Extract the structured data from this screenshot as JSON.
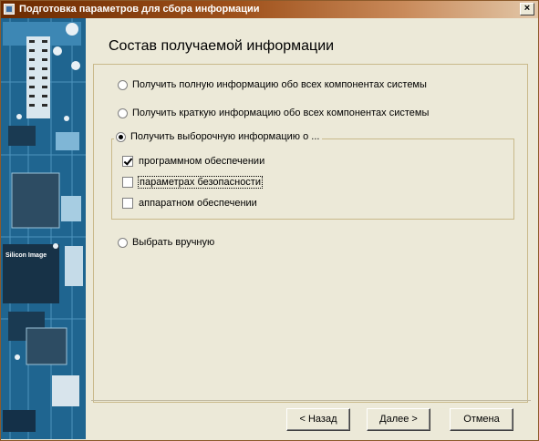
{
  "window": {
    "title": "Подготовка параметров для сбора информации",
    "close_label": "×"
  },
  "page": {
    "heading": "Состав получаемой информации"
  },
  "options": [
    {
      "label": "Получить полную информацию обо всех компонентах системы",
      "checked": false
    },
    {
      "label": "Получить краткую информацию обо всех компонентах системы",
      "checked": false
    },
    {
      "label": "Получить выборочную информацию о ...",
      "checked": true
    },
    {
      "label": "Выбрать вручную",
      "checked": false
    }
  ],
  "selective": {
    "items": [
      {
        "label": "программном обеспечении",
        "checked": true
      },
      {
        "label": "параметрах безопасности",
        "checked": false
      },
      {
        "label": "аппаратном обеспечении",
        "checked": false
      }
    ]
  },
  "buttons": {
    "back": "< Назад",
    "next": "Далее >",
    "cancel": "Отмена"
  },
  "side_art": {
    "chip_text": "Silicon Image"
  }
}
